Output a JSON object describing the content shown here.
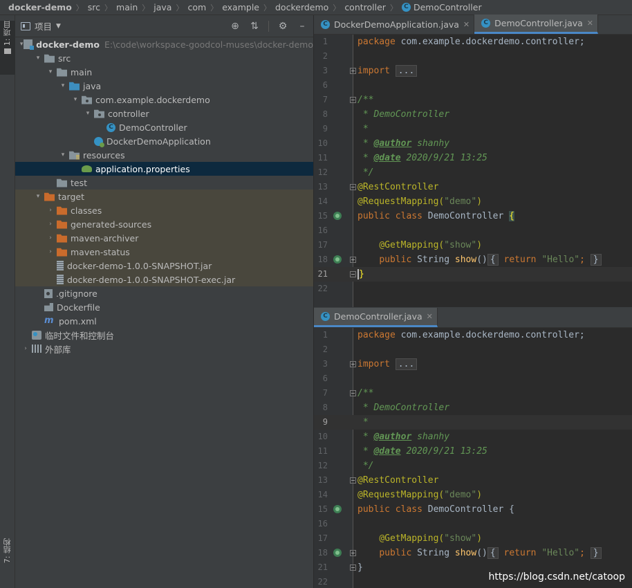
{
  "breadcrumb": [
    "docker-demo",
    "src",
    "main",
    "java",
    "com",
    "example",
    "dockerdemo",
    "controller",
    "DemoController"
  ],
  "left_strip": {
    "project_label": "1: 项目",
    "structure_label": "7: 结构"
  },
  "panel": {
    "title": "项目",
    "tree": [
      {
        "depth": 0,
        "arrow": "▾",
        "icon": "module",
        "label": "docker-demo",
        "bold": true,
        "path": "E:\\code\\workspace-goodcol-muses\\docker-demo"
      },
      {
        "depth": 1,
        "arrow": "▾",
        "icon": "folder",
        "label": "src"
      },
      {
        "depth": 2,
        "arrow": "▾",
        "icon": "folder",
        "label": "main"
      },
      {
        "depth": 3,
        "arrow": "▾",
        "icon": "folder-blue",
        "label": "java"
      },
      {
        "depth": 4,
        "arrow": "▾",
        "icon": "package",
        "label": "com.example.dockerdemo"
      },
      {
        "depth": 5,
        "arrow": "▾",
        "icon": "package",
        "label": "controller"
      },
      {
        "depth": 6,
        "arrow": "",
        "icon": "class",
        "label": "DemoController"
      },
      {
        "depth": 5,
        "arrow": "",
        "icon": "spring",
        "label": "DockerDemoApplication"
      },
      {
        "depth": 3,
        "arrow": "▾",
        "icon": "resources",
        "label": "resources"
      },
      {
        "depth": 4,
        "arrow": "",
        "icon": "props",
        "label": "application.properties",
        "selected": true
      },
      {
        "depth": 2,
        "arrow": "",
        "icon": "folder",
        "label": "test"
      },
      {
        "depth": 1,
        "arrow": "▾",
        "icon": "folder-orange",
        "label": "target",
        "target": true
      },
      {
        "depth": 2,
        "arrow": "›",
        "icon": "folder-orange",
        "label": "classes",
        "target": true
      },
      {
        "depth": 2,
        "arrow": "›",
        "icon": "folder-orange",
        "label": "generated-sources",
        "target": true
      },
      {
        "depth": 2,
        "arrow": "›",
        "icon": "folder-orange",
        "label": "maven-archiver",
        "target": true
      },
      {
        "depth": 2,
        "arrow": "›",
        "icon": "folder-orange",
        "label": "maven-status",
        "target": true
      },
      {
        "depth": 2,
        "arrow": "",
        "icon": "jar",
        "label": "docker-demo-1.0.0-SNAPSHOT.jar",
        "target": true
      },
      {
        "depth": 2,
        "arrow": "",
        "icon": "jar",
        "label": "docker-demo-1.0.0-SNAPSHOT-exec.jar",
        "target": true
      },
      {
        "depth": 1,
        "arrow": "",
        "icon": "git",
        "label": ".gitignore"
      },
      {
        "depth": 1,
        "arrow": "",
        "icon": "docker",
        "label": "Dockerfile"
      },
      {
        "depth": 1,
        "arrow": "",
        "icon": "maven",
        "label": "pom.xml"
      },
      {
        "depth": 0,
        "arrow": "",
        "icon": "scratch",
        "label": "临时文件和控制台"
      },
      {
        "depth": 0,
        "arrow": "›",
        "icon": "libs",
        "label": "外部库"
      }
    ]
  },
  "editor_top": {
    "tabs": [
      {
        "label": "DockerDemoApplication.java",
        "active": false
      },
      {
        "label": "DemoController.java",
        "active": true
      }
    ],
    "current_line": 21,
    "ends_with_caret_brace": true
  },
  "editor_bottom": {
    "tabs": [
      {
        "label": "DemoController.java",
        "active": true
      }
    ],
    "current_line": 9,
    "ends_with_caret_brace": false
  },
  "code": {
    "line_numbers": [
      "1",
      "2",
      "3",
      "6",
      "7",
      "8",
      "9",
      "10",
      "11",
      "12",
      "13",
      "14",
      "15",
      "16",
      "17",
      "18",
      "21",
      "22"
    ],
    "package_kw": "package",
    "package_name": " com.example.dockerdemo.controller;",
    "import_kw": "import",
    "import_folded": "...",
    "doc_open": "/**",
    "doc_name": " * DemoController",
    "doc_star": " *",
    "doc_author_tag": "@author",
    "doc_author_val": " shanhy",
    "doc_date_tag": "@date",
    "doc_date_val": " 2020/9/21 13:25",
    "doc_close": " */",
    "rest_controller": "@RestController",
    "request_mapping": "@RequestMapping(",
    "request_mapping_path": "\"demo\"",
    "class_decl_kw": "public class",
    "class_name": " DemoController ",
    "get_mapping": "@GetMapping(",
    "get_mapping_path": "\"show\"",
    "method_kw": "public",
    "method_type": " String ",
    "method_name": "show",
    "method_body_kw": "return",
    "method_body_str": "\"Hello\"",
    "close_brace": "}"
  },
  "watermark": "https://blog.csdn.net/catoop"
}
